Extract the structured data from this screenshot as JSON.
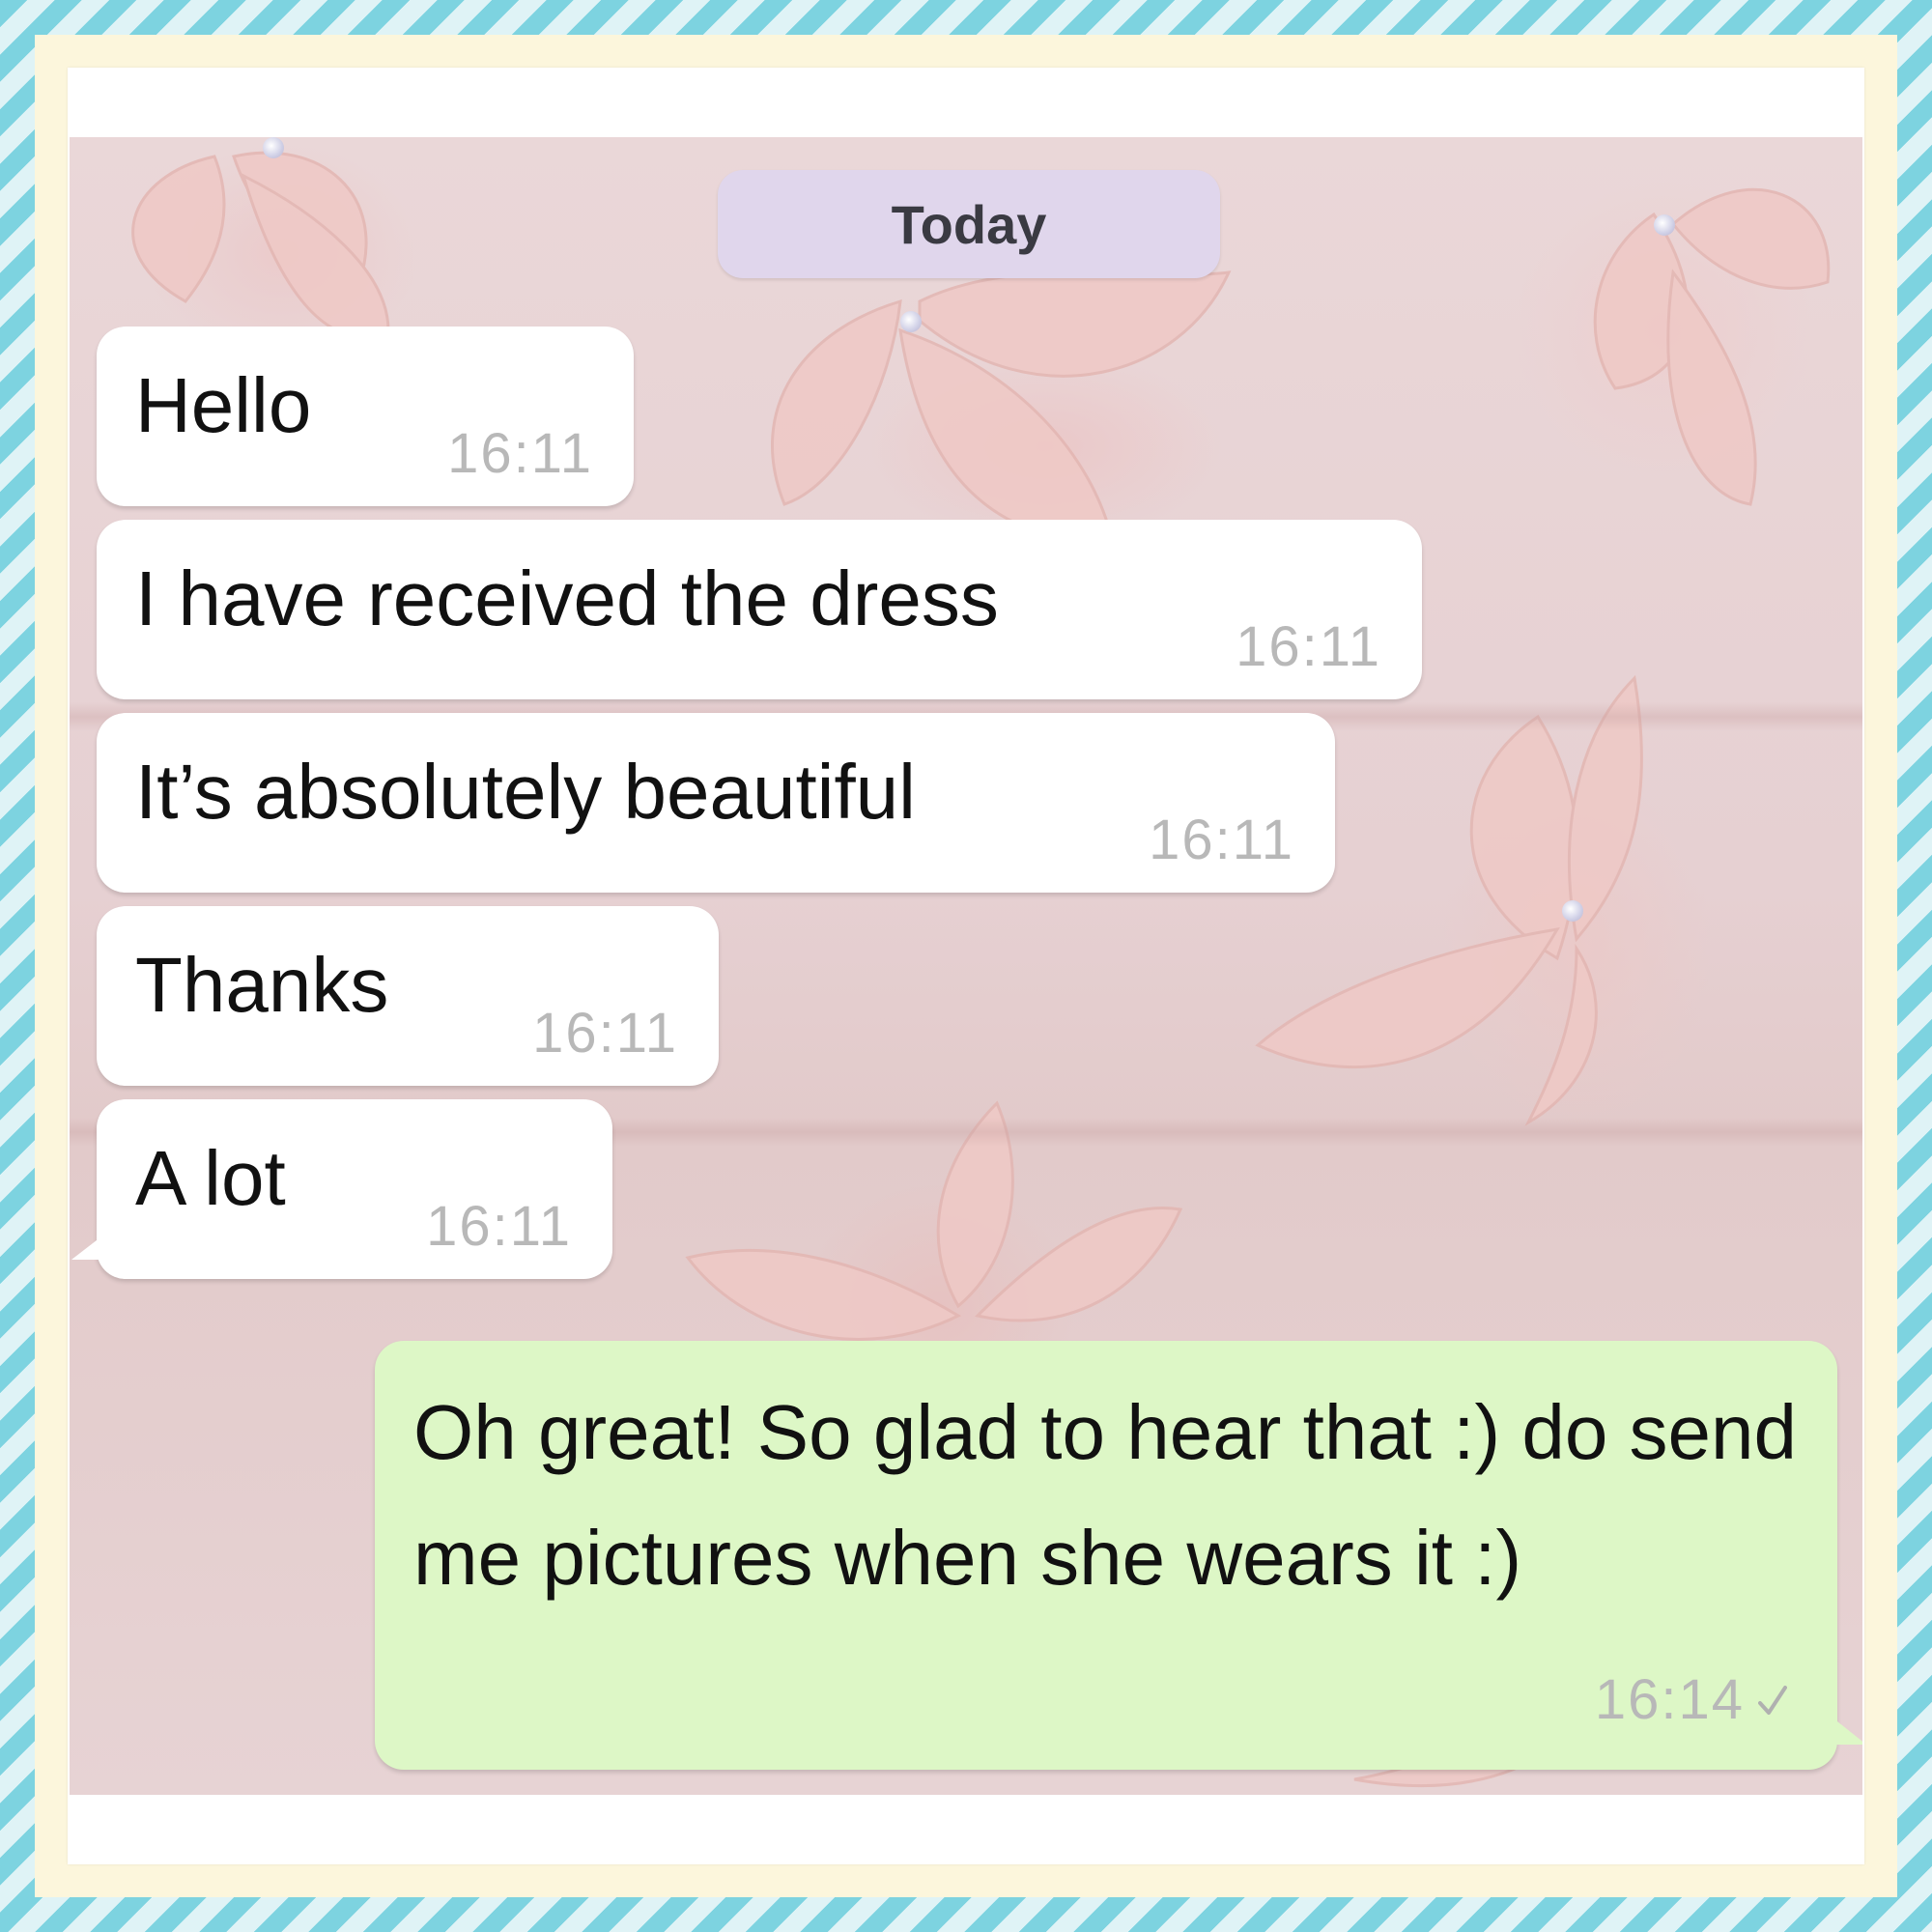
{
  "chat": {
    "date_label": "Today",
    "incoming_messages": [
      {
        "text": "Hello",
        "time": "16:11"
      },
      {
        "text": "I have received the dress",
        "time": "16:11"
      },
      {
        "text": "It’s absolutely beautiful",
        "time": "16:11"
      },
      {
        "text": "Thanks",
        "time": "16:11"
      },
      {
        "text": "A lot",
        "time": "16:11"
      }
    ],
    "outgoing_message": {
      "text": "Oh great! So glad to hear that :) do send me pictures when she wears it :)",
      "time": "16:14",
      "status_icon": "check-icon"
    }
  },
  "colors": {
    "incoming_bubble": "#ffffff",
    "outgoing_bubble": "#ddf7c6",
    "date_pill": "#e0d6ec",
    "timestamp": "#b8b8b8",
    "frame_stripe": "#7dd3e0",
    "frame_cream": "#fcf6dc"
  }
}
